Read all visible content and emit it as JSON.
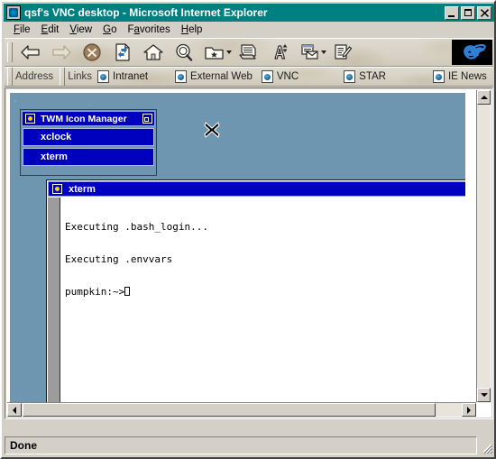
{
  "window": {
    "title": "qsf's VNC desktop - Microsoft Internet Explorer",
    "icon_name": "ie-document-icon",
    "controls": {
      "minimize_label": "_",
      "maximize_label": "□",
      "close_label": "✕"
    },
    "titlebar_color": "#008080",
    "chrome_color": "#d4d0c8"
  },
  "menubar": {
    "items": [
      {
        "label": "File",
        "accel": "F"
      },
      {
        "label": "Edit",
        "accel": "E"
      },
      {
        "label": "View",
        "accel": "V"
      },
      {
        "label": "Go",
        "accel": "G"
      },
      {
        "label": "Favorites",
        "accel": "a"
      },
      {
        "label": "Help",
        "accel": "H"
      }
    ]
  },
  "toolbar": {
    "buttons": [
      {
        "name": "back-button",
        "icon": "arrow-left-icon",
        "has_dropdown": false
      },
      {
        "name": "forward-button",
        "icon": "arrow-right-icon",
        "has_dropdown": false
      },
      {
        "name": "stop-button",
        "icon": "stop-x-icon",
        "has_dropdown": false
      },
      {
        "name": "refresh-button",
        "icon": "refresh-page-icon",
        "has_dropdown": false
      },
      {
        "name": "home-button",
        "icon": "home-icon",
        "has_dropdown": false
      },
      {
        "name": "search-button",
        "icon": "magnifier-icon",
        "has_dropdown": false
      },
      {
        "name": "favorites-button",
        "icon": "favorites-folder-icon",
        "has_dropdown": true
      },
      {
        "name": "print-button",
        "icon": "printer-icon",
        "has_dropdown": false
      },
      {
        "name": "font-button",
        "icon": "font-size-icon",
        "has_dropdown": false
      },
      {
        "name": "mail-button",
        "icon": "mail-icon",
        "has_dropdown": true
      },
      {
        "name": "edit-button",
        "icon": "edit-page-icon",
        "has_dropdown": false
      }
    ],
    "brand_icon": "internet-explorer-logo"
  },
  "linksbar": {
    "address_label": "Address",
    "links_label": "Links",
    "links": [
      {
        "label": "Intranet"
      },
      {
        "label": "External Web"
      },
      {
        "label": "VNC"
      },
      {
        "label": "STAR"
      },
      {
        "label": "IE News"
      }
    ]
  },
  "vnc": {
    "desktop_color": "#6e96b0",
    "cursor_icon": "x-cursor",
    "icon_manager": {
      "title": "TWM Icon Manager",
      "menu_button_icon": "twm-menu-dot-icon",
      "resize_button_icon": "twm-resize-icon",
      "titlebar_color": "#0000bf",
      "entries": [
        {
          "label": "xclock"
        },
        {
          "label": "xterm"
        }
      ]
    },
    "xterm": {
      "title": "xterm",
      "menu_button_icon": "twm-menu-dot-icon",
      "resize_button_icon": "twm-resize-icon",
      "background": "#ffffff",
      "foreground": "#000000",
      "lines": [
        "Executing .bash_login...",
        "Executing .envvars"
      ],
      "prompt": "pumpkin:~>"
    }
  },
  "scrollbars": {
    "vertical": {
      "up_icon": "scroll-up-arrow-icon",
      "down_icon": "scroll-down-arrow-icon"
    },
    "horizontal": {
      "left_icon": "scroll-left-arrow-icon",
      "right_icon": "scroll-right-arrow-icon"
    }
  },
  "statusbar": {
    "text": "Done",
    "grip_icon": "resize-grip-icon"
  }
}
